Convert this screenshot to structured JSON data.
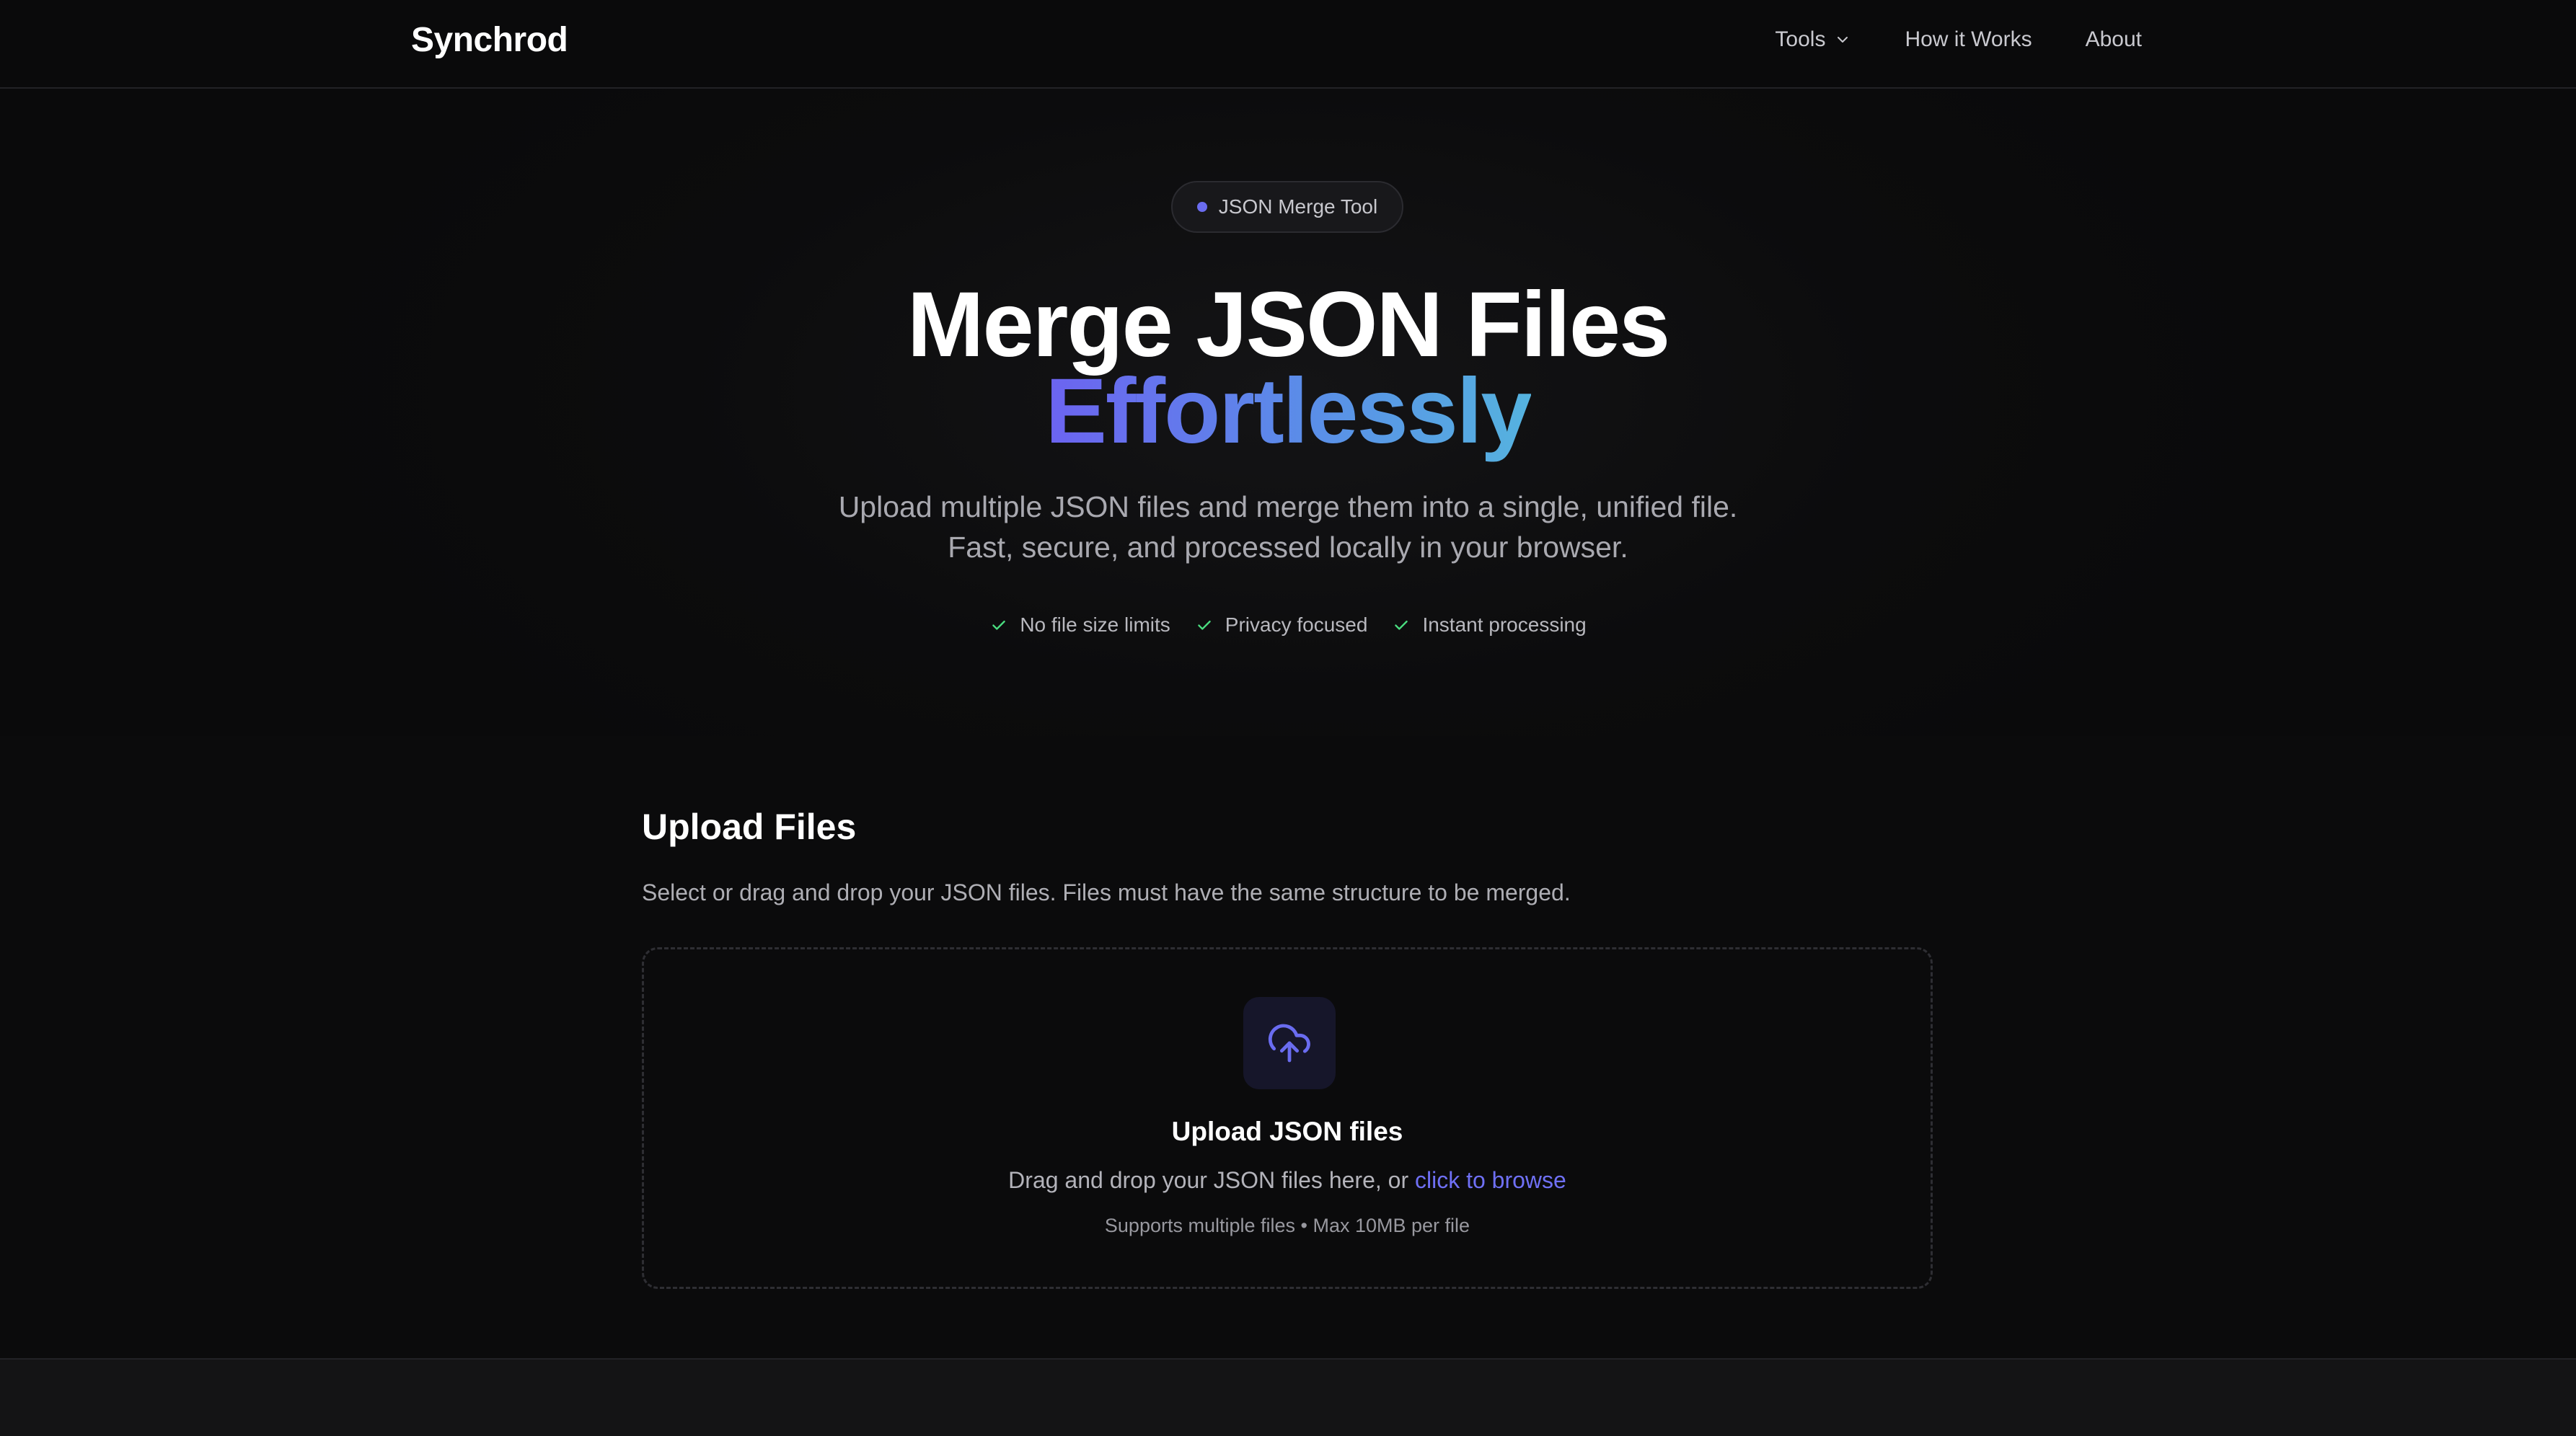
{
  "nav": {
    "brand": "Synchrod",
    "links": [
      "Tools",
      "How it Works",
      "About"
    ]
  },
  "hero": {
    "badge": "JSON Merge Tool",
    "title_line1": "Merge JSON Files",
    "title_line2": "Effortlessly",
    "subtitle_line1": "Upload multiple JSON files and merge them into a single, unified file.",
    "subtitle_line2": "Fast, secure, and processed locally in your browser.",
    "features": [
      "No file size limits",
      "Privacy focused",
      "Instant processing"
    ]
  },
  "upload": {
    "title": "Upload Files",
    "description": "Select or drag and drop your JSON files. Files must have the same structure to be merged.",
    "dropzone": {
      "icon": "cloud-upload-icon",
      "title": "Upload JSON files",
      "text": "Drag and drop your JSON files here, or",
      "link": "click to browse",
      "note": "Supports multiple files • Max 10MB per file"
    }
  },
  "colors": {
    "accent": "#6a6cf0",
    "gradient_start": "#6c63f0",
    "gradient_end": "#55b3df",
    "check": "#4ade80",
    "background": "#0b0b0c"
  }
}
